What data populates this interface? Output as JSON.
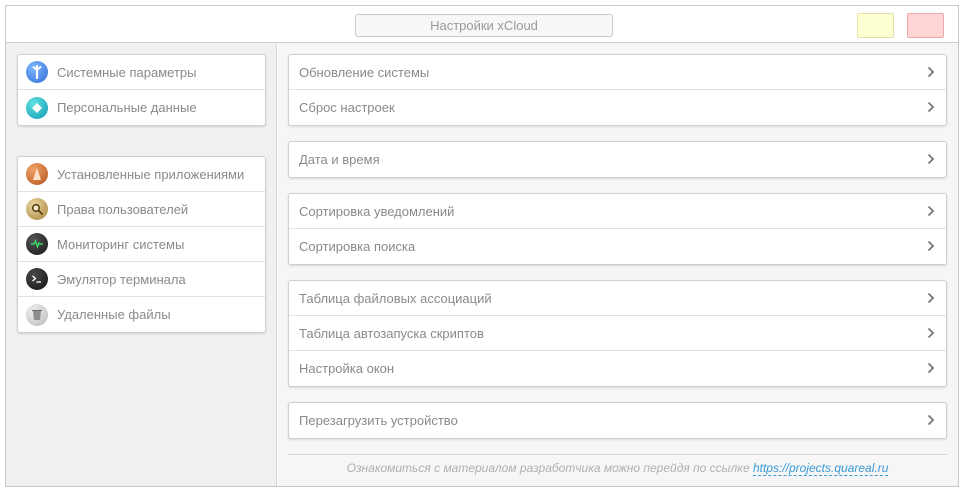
{
  "window": {
    "title": "Настройки xCloud"
  },
  "sidebar": {
    "groups": [
      {
        "items": [
          {
            "label": "Системные параметры",
            "icon": "wrench-icon"
          },
          {
            "label": "Персональные данные",
            "icon": "diamond-icon"
          }
        ]
      },
      {
        "items": [
          {
            "label": "Установленные приложениями",
            "icon": "cone-icon"
          },
          {
            "label": "Права пользователей",
            "icon": "magnifier-icon"
          },
          {
            "label": "Мониторинг системы",
            "icon": "pulse-icon"
          },
          {
            "label": "Эмулятор терминала",
            "icon": "terminal-icon"
          },
          {
            "label": "Удаленные файлы",
            "icon": "trash-icon"
          }
        ]
      }
    ]
  },
  "main": {
    "sections": [
      {
        "rows": [
          "Обновление системы",
          "Сброс настроек"
        ]
      },
      {
        "rows": [
          "Дата и время"
        ]
      },
      {
        "rows": [
          "Сортировка уведомлений",
          "Сортировка поиска"
        ]
      },
      {
        "rows": [
          "Таблица файловых ассоциаций",
          "Таблица автозапуска скриптов",
          "Настройка окон"
        ]
      },
      {
        "rows": [
          "Перезагрузить устройство"
        ]
      }
    ]
  },
  "footer": {
    "text": "Ознакомиться с материалом разработчика можно перейдя по ссылке",
    "link": "https://projects.quareal.ru"
  },
  "colors": {
    "minimize_button": "#ffffd4",
    "close_button": "#ffd5d5",
    "link": "#3a9bd8"
  }
}
